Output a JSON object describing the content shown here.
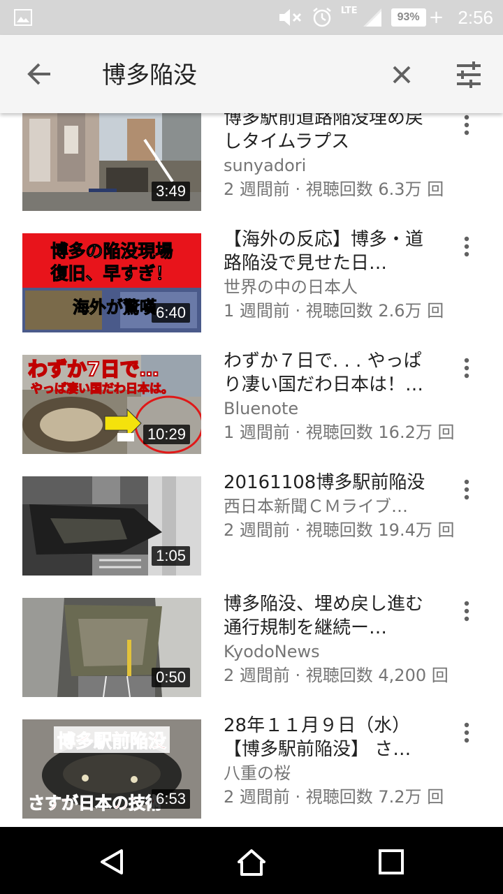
{
  "status_bar": {
    "time": "2:56",
    "battery": "93%",
    "network": "LTE",
    "icons": [
      "gallery-icon",
      "mute-icon",
      "alarm-icon",
      "lte-signal-icon",
      "battery-icon"
    ]
  },
  "search_bar": {
    "query": "博多陥没",
    "icons": [
      "back-arrow-icon",
      "clear-icon",
      "filter-icon"
    ]
  },
  "results": [
    {
      "title": "博多駅前道路陥没埋め戻しタイムラプス",
      "channel": "sunyadori",
      "stats": "2 週間前 · 視聴回数 6.3万 回",
      "duration": "3:49"
    },
    {
      "title": "【海外の反応】博多・道路陥没で見せた日…",
      "channel": "世界の中の日本人",
      "stats": "1 週間前 · 視聴回数 2.6万 回",
      "duration": "6:40",
      "thumb_text": [
        "博多の陥没現場",
        "復旧、早すぎ！",
        "海外が驚嘆"
      ]
    },
    {
      "title": "わずか７日で. . . やっぱり凄い国だわ日本は！…",
      "channel": "Bluenote",
      "stats": "1 週間前 · 視聴回数 16.2万 回",
      "duration": "10:29",
      "thumb_text": [
        "わずか7日で…",
        "やっぱ凄い国だわ日本は。"
      ]
    },
    {
      "title": "20161108博多駅前陥没",
      "channel": "西日本新聞ＣＭライブ…",
      "stats": "2 週間前 · 視聴回数 19.4万 回",
      "duration": "1:05"
    },
    {
      "title": "博多陥没、埋め戻し進む 通行規制を継続ー…",
      "channel": "KyodoNews",
      "stats": "2 週間前 · 視聴回数 4,200 回",
      "duration": "0:50"
    },
    {
      "title": "28年１１月９日（水）【博多駅前陥没】 さ…",
      "channel": "八重の桜",
      "stats": "2 週間前 · 視聴回数 7.2万 回",
      "duration": "6:53",
      "thumb_text": [
        "博多駅前陥没",
        "さすが日本の技術"
      ]
    }
  ],
  "nav_bar": {
    "icons": [
      "nav-back-icon",
      "nav-home-icon",
      "nav-recents-icon"
    ]
  }
}
